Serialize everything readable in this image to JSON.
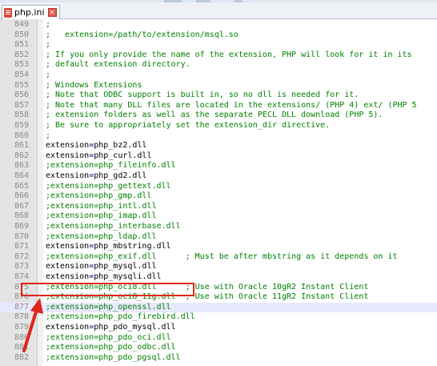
{
  "tab": {
    "label": "php.ini",
    "close": "×"
  },
  "colors": {
    "accent": "#e0251b",
    "comment": "#008000",
    "operator": "#000080",
    "current_line": "#e8e8ff"
  },
  "editor": {
    "current_line": "877",
    "highlighted_line": "877",
    "lines": [
      {
        "n": "849",
        "type": "comment",
        "text": ";"
      },
      {
        "n": "850",
        "type": "comment",
        "text": ";   extension=/path/to/extension/msql.so"
      },
      {
        "n": "851",
        "type": "comment",
        "text": ";"
      },
      {
        "n": "852",
        "type": "comment",
        "text": "; If you only provide the name of the extension, PHP will look for it in its"
      },
      {
        "n": "853",
        "type": "comment",
        "text": "; default extension directory."
      },
      {
        "n": "854",
        "type": "comment",
        "text": ";"
      },
      {
        "n": "855",
        "type": "comment",
        "text": "; Windows Extensions"
      },
      {
        "n": "856",
        "type": "comment",
        "text": "; Note that ODBC support is built in, so no dll is needed for it."
      },
      {
        "n": "857",
        "type": "comment",
        "text": "; Note that many DLL files are located in the extensions/ (PHP 4) ext/ (PHP 5"
      },
      {
        "n": "858",
        "type": "comment",
        "text": "; extension folders as well as the separate PECL DLL download (PHP 5)."
      },
      {
        "n": "859",
        "type": "comment",
        "text": "; Be sure to appropriately set the extension_dir directive."
      },
      {
        "n": "860",
        "type": "comment",
        "text": ";"
      },
      {
        "n": "861",
        "type": "kv",
        "key": "extension",
        "value": "php_bz2.dll"
      },
      {
        "n": "862",
        "type": "kv",
        "key": "extension",
        "value": "php_curl.dll"
      },
      {
        "n": "863",
        "type": "comment",
        "text": ";extension=php_fileinfo.dll"
      },
      {
        "n": "864",
        "type": "kv",
        "key": "extension",
        "value": "php_gd2.dll"
      },
      {
        "n": "865",
        "type": "comment",
        "text": ";extension=php_gettext.dll"
      },
      {
        "n": "866",
        "type": "comment",
        "text": ";extension=php_gmp.dll"
      },
      {
        "n": "867",
        "type": "comment",
        "text": ";extension=php_intl.dll"
      },
      {
        "n": "868",
        "type": "comment",
        "text": ";extension=php_imap.dll"
      },
      {
        "n": "869",
        "type": "comment",
        "text": ";extension=php_interbase.dll"
      },
      {
        "n": "870",
        "type": "comment",
        "text": ";extension=php_ldap.dll"
      },
      {
        "n": "871",
        "type": "kv",
        "key": "extension",
        "value": "php_mbstring.dll"
      },
      {
        "n": "872",
        "type": "comment",
        "text": ";extension=php_exif.dll      ; Must be after mbstring as it depends on it"
      },
      {
        "n": "873",
        "type": "kv",
        "key": "extension",
        "value": "php_mysql.dll"
      },
      {
        "n": "874",
        "type": "kv",
        "key": "extension",
        "value": "php_mysqli.dll"
      },
      {
        "n": "875",
        "type": "comment",
        "text": ";extension=php_oci8.dll      ; Use with Oracle 10gR2 Instant Client"
      },
      {
        "n": "876",
        "type": "comment",
        "text": ";extension=php_oci8_11g.dll  ; Use with Oracle 11gR2 Instant Client"
      },
      {
        "n": "877",
        "type": "comment",
        "text": ";extension=php_openssl.dll"
      },
      {
        "n": "878",
        "type": "comment",
        "text": ";extension=php_pdo_firebird.dll"
      },
      {
        "n": "879",
        "type": "kv",
        "key": "extension",
        "value": "php_pdo_mysql.dll"
      },
      {
        "n": "880",
        "type": "comment",
        "text": ";extension=php_pdo_oci.dll"
      },
      {
        "n": "881",
        "type": "comment",
        "text": ";extension=php_pdo_odbc.dll"
      },
      {
        "n": "882",
        "type": "comment",
        "text": ";extension=php_pdo_pgsql.dll"
      }
    ]
  }
}
